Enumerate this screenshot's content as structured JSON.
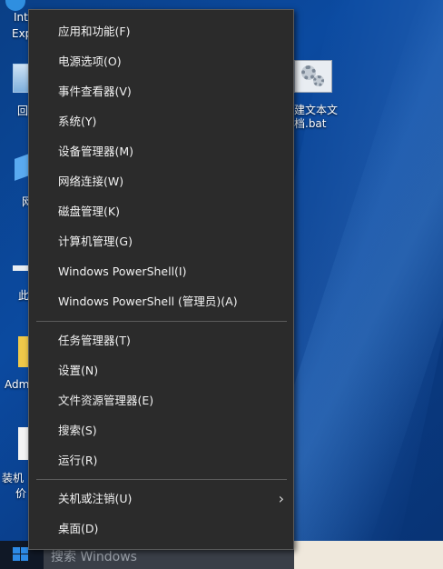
{
  "desktop": {
    "left_icons": [
      {
        "label": "Int",
        "icon": "internet-explorer-icon"
      },
      {
        "label": "Exp",
        "icon": "internet-explorer-icon"
      },
      {
        "label": "回",
        "icon": "recycle-bin-icon"
      },
      {
        "label": "网",
        "icon": "network-icon"
      },
      {
        "label": "此",
        "icon": "this-pc-icon"
      },
      {
        "label": "Adm",
        "icon": "user-folder-icon"
      },
      {
        "label": "装机",
        "icon": "document-icon"
      },
      {
        "label": "价",
        "icon": "document-icon"
      }
    ],
    "right_file": {
      "label_line1": "建文本文",
      "label_line2": "档.bat",
      "icon": "batch-file-gear-icon"
    }
  },
  "context_menu": {
    "items_group1": [
      "应用和功能(F)",
      "电源选项(O)",
      "事件查看器(V)",
      "系统(Y)",
      "设备管理器(M)",
      "网络连接(W)",
      "磁盘管理(K)",
      "计算机管理(G)",
      "Windows PowerShell(I)",
      "Windows PowerShell (管理员)(A)"
    ],
    "items_group2": [
      "任务管理器(T)",
      "设置(N)",
      "文件资源管理器(E)",
      "搜索(S)",
      "运行(R)"
    ],
    "items_group3": [
      "关机或注销(U)",
      "桌面(D)"
    ],
    "submenu_chevron": "›"
  },
  "taskbar": {
    "search_placeholder": "搜索 Windows",
    "start_icon": "windows-logo-icon"
  },
  "colors": {
    "menu_bg": "#2b2b2b",
    "menu_text": "#f2f2f2",
    "desktop_blue": "#0a3f86",
    "taskbar": "#101826",
    "windows_blue": "#2d8ae5"
  }
}
